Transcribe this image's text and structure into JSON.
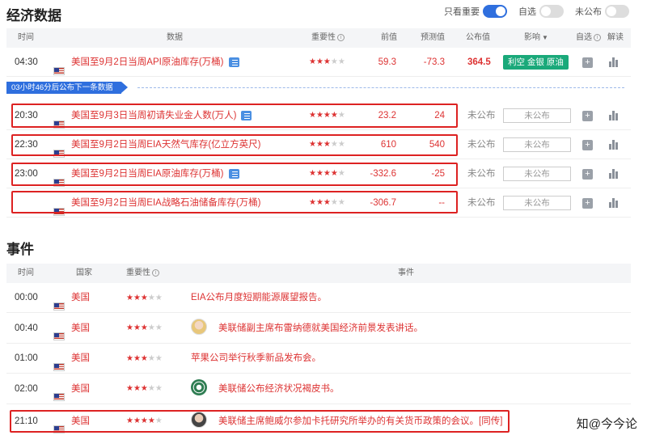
{
  "econ": {
    "title": "经济数据",
    "toggles": [
      {
        "label": "只看重要",
        "on": true
      },
      {
        "label": "自选",
        "on": false
      },
      {
        "label": "未公布",
        "on": false
      }
    ],
    "headers": {
      "time": "时间",
      "data": "数据",
      "importance": "重要性",
      "prev": "前值",
      "forecast": "预测值",
      "actual": "公布值",
      "impact": "影响",
      "watch": "自选",
      "explain": "解读"
    },
    "rows": [
      {
        "time": "04:30",
        "title": "美国至9月2日当周API原油库存(万桶)",
        "stars": 3,
        "prev": "59.3",
        "forecast": "-73.3",
        "actual": "364.5",
        "impact": "利空 金银 原油",
        "has_doc": true
      },
      {
        "time": "20:30",
        "title": "美国至9月3日当周初请失业金人数(万人)",
        "stars": 4,
        "prev": "23.2",
        "forecast": "24",
        "actual": "未公布",
        "impact": "未公布",
        "has_doc": true
      },
      {
        "time": "22:30",
        "title": "美国至9月2日当周EIA天然气库存(亿立方英尺)",
        "stars": 3,
        "prev": "610",
        "forecast": "540",
        "actual": "未公布",
        "impact": "未公布",
        "has_doc": false
      },
      {
        "time": "23:00",
        "title": "美国至9月2日当周EIA原油库存(万桶)",
        "stars": 4,
        "prev": "-332.6",
        "forecast": "-25",
        "actual": "未公布",
        "impact": "未公布",
        "has_doc": true
      },
      {
        "time": "",
        "title": "美国至9月2日当周EIA战略石油储备库存(万桶)",
        "stars": 3,
        "prev": "-306.7",
        "forecast": "--",
        "actual": "未公布",
        "impact": "未公布",
        "has_doc": false
      }
    ],
    "notice": "03小时46分后公布下一条数据"
  },
  "events": {
    "title": "事件",
    "headers": {
      "time": "时间",
      "country": "国家",
      "importance": "重要性",
      "event": "事件"
    },
    "rows": [
      {
        "time": "00:00",
        "country": "美国",
        "stars": 3,
        "avatar": "none",
        "text": "EIA公布月度短期能源展望报告。"
      },
      {
        "time": "00:40",
        "country": "美国",
        "stars": 3,
        "avatar": "woman-avatar-icon",
        "text": "美联储副主席布雷纳德就美国经济前景发表讲话。"
      },
      {
        "time": "01:00",
        "country": "美国",
        "stars": 3,
        "avatar": "none",
        "text": "苹果公司举行秋季新品发布会。"
      },
      {
        "time": "02:00",
        "country": "美国",
        "stars": 3,
        "avatar": "fed-seal-icon",
        "text": "美联储公布经济状况褐皮书。"
      },
      {
        "time": "21:10",
        "country": "美国",
        "stars": 4,
        "avatar": "man-avatar-icon",
        "text": "美联储主席鲍威尔参加卡托研究所举办的有关货币政策的会议。[同传]"
      }
    ]
  },
  "watermark": "知@今今论",
  "colors": {
    "accent": "#2f6fde",
    "red": "#dd3333",
    "green": "#1aa97a",
    "highlight": "#dd2222"
  }
}
